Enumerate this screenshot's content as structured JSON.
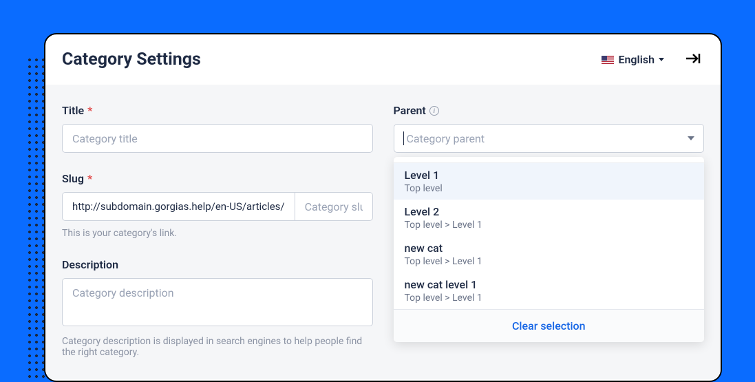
{
  "header": {
    "title": "Category Settings",
    "language_label": "English"
  },
  "form": {
    "title": {
      "label": "Title",
      "placeholder": "Category title"
    },
    "parent": {
      "label": "Parent",
      "placeholder": "Category parent"
    },
    "slug": {
      "label": "Slug",
      "prefix": "http://subdomain.gorgias.help/en-US/articles/",
      "placeholder": "Category slug",
      "helper": "This is your category's link."
    },
    "description": {
      "label": "Description",
      "placeholder": "Category description",
      "helper": "Category description is displayed in search engines to help people find the right category."
    }
  },
  "dropdown": {
    "items": [
      {
        "title": "Level 1",
        "sub": "Top level",
        "highlighted": true
      },
      {
        "title": "Level 2",
        "sub": "Top level > Level 1",
        "highlighted": false
      },
      {
        "title": "new cat",
        "sub": "Top level > Level 1",
        "highlighted": false
      },
      {
        "title": "new cat level 1",
        "sub": "Top level > Level 1",
        "highlighted": false
      }
    ],
    "clear_label": "Clear selection"
  }
}
